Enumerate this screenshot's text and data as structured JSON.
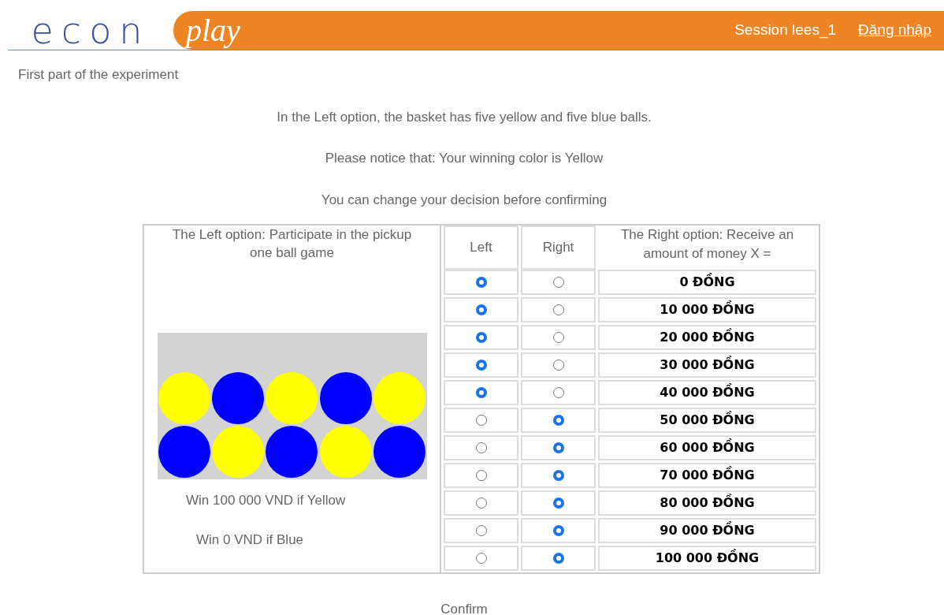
{
  "header": {
    "logo_left": "econ",
    "logo_right": "play",
    "session": "Session lees_1",
    "login_link": "Đăng nhập"
  },
  "page_title": "First part of the experiment",
  "instructions": [
    "In the Left option, the basket has five yellow and five blue balls.",
    "Please notice that: Your winning color is Yellow",
    "You can change your decision before confirming"
  ],
  "table": {
    "left_option_heading": "The Left option: Participate in the pickup one ball game",
    "column_left": "Left",
    "column_right": "Right",
    "right_option_heading": "The Right option: Receive an amount of money X =",
    "balls": [
      {
        "color": "#ffff00"
      },
      {
        "color": "#0000ff"
      },
      {
        "color": "#ffff00"
      },
      {
        "color": "#0000ff"
      },
      {
        "color": "#ffff00"
      },
      {
        "color": "#0000ff"
      },
      {
        "color": "#ffff00"
      },
      {
        "color": "#0000ff"
      },
      {
        "color": "#ffff00"
      },
      {
        "color": "#0000ff"
      }
    ],
    "win_texts": [
      "Win 100 000 VND if Yellow",
      "Win 0 VND if Blue"
    ],
    "rows": [
      {
        "amount": "0 ĐỒNG",
        "options": [
          {
            "selected": true
          },
          {
            "selected": false
          }
        ]
      },
      {
        "amount": "10 000 ĐỒNG",
        "options": [
          {
            "selected": true
          },
          {
            "selected": false
          }
        ]
      },
      {
        "amount": "20 000 ĐỒNG",
        "options": [
          {
            "selected": true
          },
          {
            "selected": false
          }
        ]
      },
      {
        "amount": "30 000 ĐỒNG",
        "options": [
          {
            "selected": true
          },
          {
            "selected": false
          }
        ]
      },
      {
        "amount": "40 000 ĐỒNG",
        "options": [
          {
            "selected": true
          },
          {
            "selected": false
          }
        ]
      },
      {
        "amount": "50 000 ĐỒNG",
        "options": [
          {
            "selected": false
          },
          {
            "selected": true
          }
        ]
      },
      {
        "amount": "60 000 ĐỒNG",
        "options": [
          {
            "selected": false
          },
          {
            "selected": true
          }
        ]
      },
      {
        "amount": "70 000 ĐỒNG",
        "options": [
          {
            "selected": false
          },
          {
            "selected": true
          }
        ]
      },
      {
        "amount": "80 000 ĐỒNG",
        "options": [
          {
            "selected": false
          },
          {
            "selected": true
          }
        ]
      },
      {
        "amount": "90 000 ĐỒNG",
        "options": [
          {
            "selected": false
          },
          {
            "selected": true
          }
        ]
      },
      {
        "amount": "100 000 ĐỒNG",
        "options": [
          {
            "selected": false
          },
          {
            "selected": true
          }
        ]
      }
    ]
  },
  "confirm_button": "Confirm"
}
